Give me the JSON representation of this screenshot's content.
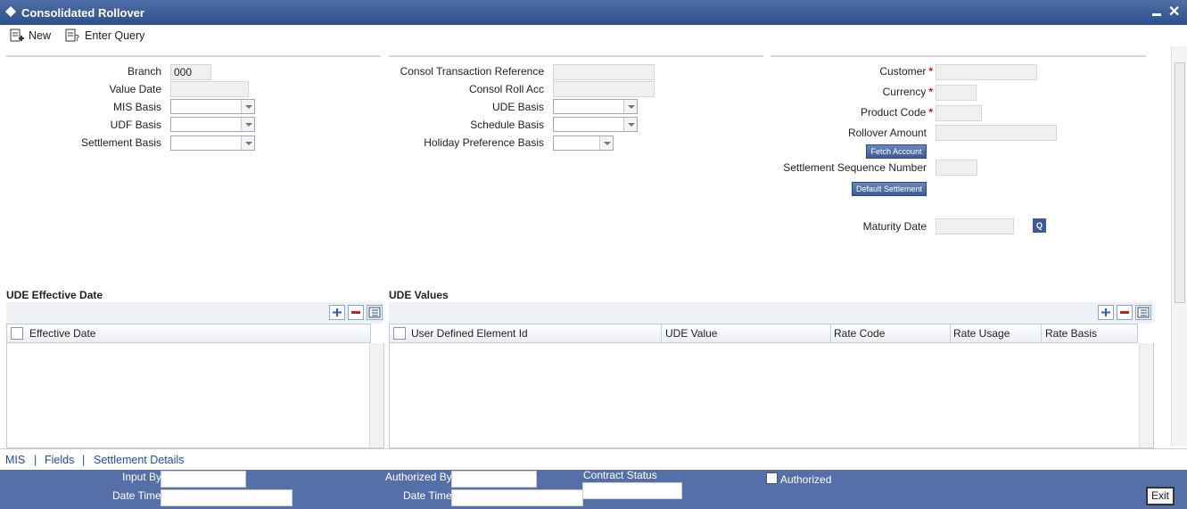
{
  "window": {
    "title": "Consolidated Rollover"
  },
  "toolbar": {
    "new_label": "New",
    "enter_query_label": "Enter Query"
  },
  "left_panel": {
    "branch_label": "Branch",
    "branch_value": "000",
    "value_date_label": "Value Date",
    "mis_basis_label": "MIS Basis",
    "udf_basis_label": "UDF Basis",
    "settlement_basis_label": "Settlement Basis"
  },
  "mid_panel": {
    "consol_ref_label": "Consol Transaction Reference",
    "consol_roll_acc_label": "Consol Roll Acc",
    "ude_basis_label": "UDE Basis",
    "schedule_basis_label": "Schedule Basis",
    "holiday_pref_label": "Holiday Preference Basis"
  },
  "right_panel": {
    "customer_label": "Customer",
    "currency_label": "Currency",
    "product_code_label": "Product Code",
    "rollover_amount_label": "Rollover Amount",
    "fetch_account_label": "Fetch Account",
    "settlement_seq_label": "Settlement Sequence Number",
    "default_settlement_label": "Default Settlement",
    "maturity_date_label": "Maturity Date",
    "required_mark": "*"
  },
  "ude_effective": {
    "title": "UDE Effective Date",
    "columns": [
      "Effective Date"
    ]
  },
  "ude_values": {
    "title": "UDE Values",
    "columns": [
      "User Defined Element Id",
      "UDE Value",
      "Rate Code",
      "Rate Usage",
      "Rate Basis"
    ]
  },
  "footer_links": [
    "MIS",
    "|",
    "Fields",
    "|",
    "Settlement Details"
  ],
  "footer": {
    "input_by_label": "Input By",
    "date_time_label": "Date Time",
    "authorized_by_label": "Authorized By",
    "date_time2_label": "Date Time",
    "contract_status_label": "Contract Status",
    "authorized_label": "Authorized",
    "exit_label": "Exit"
  },
  "colors": {
    "titlebar": "#3d5b96",
    "footer": "#5570a8",
    "required": "#dd1111"
  }
}
